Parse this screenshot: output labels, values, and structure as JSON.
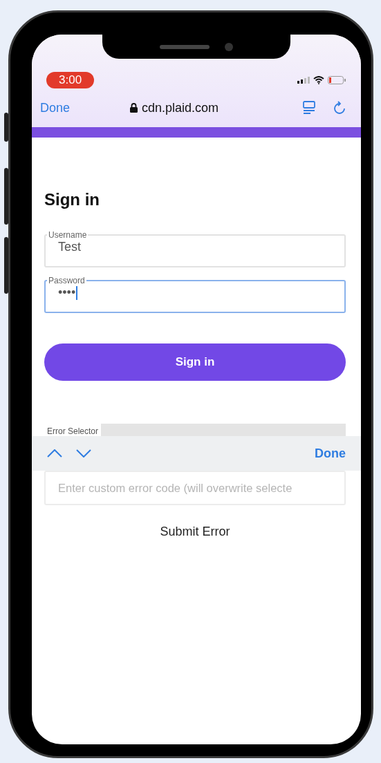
{
  "status_bar": {
    "time": "3:00"
  },
  "browser_bar": {
    "done": "Done",
    "url": "cdn.plaid.com"
  },
  "form": {
    "title": "Sign in",
    "fields": [
      {
        "label": "Username",
        "value": "Test",
        "focused": false
      },
      {
        "label": "Password",
        "value": "••••",
        "focused": true
      }
    ],
    "submit": "Sign in",
    "error_selector": {
      "label": "Error Selector"
    }
  },
  "keyboard_toolbar": {
    "done": "Done"
  },
  "custom_error": {
    "placeholder": "Enter custom error code (will overwrite selecte"
  },
  "submit_error": "Submit Error"
}
